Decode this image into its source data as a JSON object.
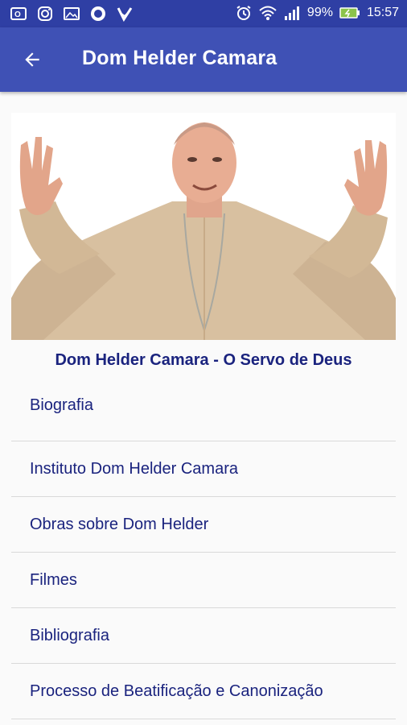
{
  "status_bar": {
    "left_icons": [
      "outlook-icon",
      "instagram-icon",
      "gallery-icon",
      "circle-app-icon",
      "checkmark-app-icon"
    ],
    "right_icons": [
      "alarm-icon",
      "wifi-icon",
      "signal-icon"
    ],
    "battery": "99%",
    "time": "15:57",
    "background_color": "#2f3fa4"
  },
  "app_bar": {
    "title": "Dom Helder Camara",
    "back_icon": "arrow-back-icon",
    "background_color": "#3f51b5"
  },
  "hero": {
    "caption": "Dom Helder Camara - O Servo de Deus"
  },
  "menu": {
    "items": [
      {
        "label": "Biografia"
      },
      {
        "label": "Instituto Dom Helder Camara"
      },
      {
        "label": "Obras sobre Dom Helder"
      },
      {
        "label": "Filmes"
      },
      {
        "label": "Bibliografia"
      },
      {
        "label": "Processo de Beatificação e Canonização"
      }
    ]
  },
  "colors": {
    "text_primary": "#1a237e",
    "divider": "#d9d9d9"
  }
}
